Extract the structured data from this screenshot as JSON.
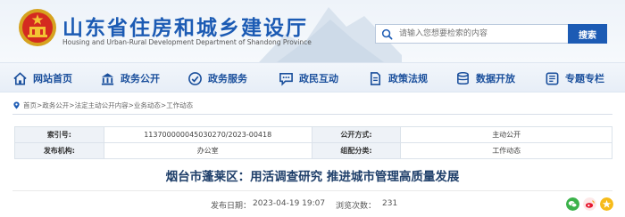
{
  "header": {
    "title": "山东省住房和城乡建设厅",
    "subtitle": "Housing and Urban-Rural Development Department of Shandong Province"
  },
  "search": {
    "placeholder": "请输入您想要检索的内容",
    "button_label": "搜索"
  },
  "nav": {
    "items": [
      {
        "label": "网站首页",
        "icon": "home-icon"
      },
      {
        "label": "政务公开",
        "icon": "building-icon"
      },
      {
        "label": "政务服务",
        "icon": "service-icon"
      },
      {
        "label": "政民互动",
        "icon": "chat-icon"
      },
      {
        "label": "政策法规",
        "icon": "document-icon"
      },
      {
        "label": "数据开放",
        "icon": "database-icon"
      },
      {
        "label": "专题专栏",
        "icon": "topic-icon"
      }
    ]
  },
  "breadcrumb": {
    "items": [
      "首页",
      "政务公开",
      "法定主动公开内容",
      "业务动态",
      "工作动态"
    ],
    "separator": ">"
  },
  "meta": {
    "index_label": "索引号:",
    "index_value": "11370000004503027​0/2023-00418",
    "method_label": "公开方式:",
    "method_value": "主动公开",
    "org_label": "发布机构:",
    "org_value": "办公室",
    "category_label": "组配分类:",
    "category_value": "工作动态"
  },
  "article": {
    "title": "烟台市蓬莱区：用活调查研究 推进城市管理高质量发展",
    "published_label": "发布日期：",
    "published_value": "2023-04-19 19:07",
    "views_label": "浏览次数：",
    "views_value": "231"
  },
  "colors": {
    "brand_blue": "#1c5bb4",
    "nav_text": "#1a4f9c",
    "wechat_green": "#3bb24a",
    "weibo_red": "#e6162d"
  }
}
